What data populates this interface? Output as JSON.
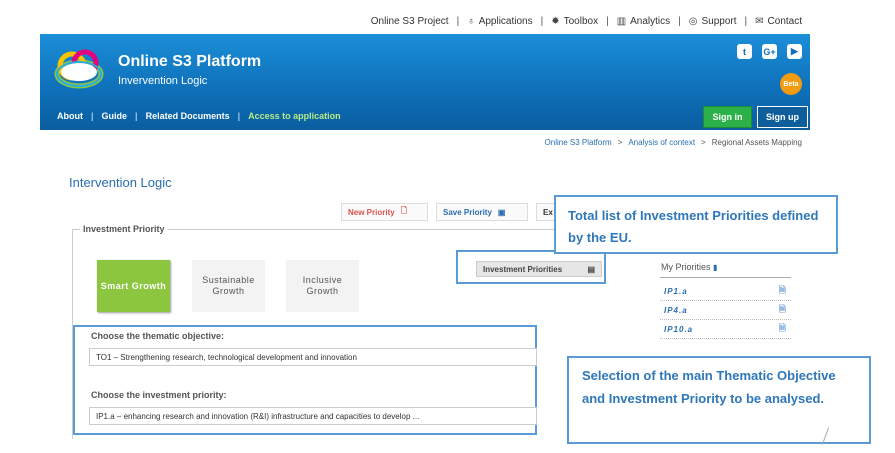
{
  "topnav": {
    "project": "Online S3 Project",
    "applications": "Applications",
    "toolbox": "Toolbox",
    "analytics": "Analytics",
    "support": "Support",
    "contact": "Contact"
  },
  "banner": {
    "title": "Online S3 Platform",
    "subtitle": "Invervention Logic",
    "social": [
      "twitter",
      "google-plus",
      "youtube"
    ],
    "beta": "Beta"
  },
  "menu": {
    "about": "About",
    "guide": "Guide",
    "related": "Related Documents",
    "access": "Access to application"
  },
  "auth": {
    "signin": "Sign in",
    "signup": "Sign up"
  },
  "breadcrumb": {
    "home": "Online S3 Platform",
    "analysis": "Analysis of context",
    "current": "Regional Assets Mapping",
    "sep": ">"
  },
  "page_title": "Intervention Logic",
  "actions": {
    "new_priority": "New Priority",
    "save_priority": "Save Priority",
    "export": "Ex"
  },
  "fieldset_legend": "Investment Priority",
  "growth": {
    "smart": "Smart Growth",
    "sustainable": "Sustainable Growth",
    "inclusive": "Inclusive Growth"
  },
  "investment_priorities_button": "Investment Priorities",
  "thematic": {
    "label": "Choose the thematic objective:",
    "value": "TO1 – Strengthening research, technological development and innovation"
  },
  "investment": {
    "label": "Choose the investment priority:",
    "value": "IP1.a – enhancing research and innovation (R&I) infrastructure and capacities to develop ..."
  },
  "my_priorities": {
    "title": "My Priorities",
    "items": [
      "IP1.a",
      "IP4.a",
      "IP10.a"
    ]
  },
  "callouts": {
    "total_list": "Total list of Investment Priorities defined by the EU.",
    "selection": "Selection of the main Thematic Objective and Investment Priority to be analysed."
  },
  "colors": {
    "banner": "#0e6fb8",
    "accent_green": "#8cc63f",
    "signin": "#2bb04a",
    "callout_border": "#5b9bd5",
    "link": "#2a6db0"
  }
}
